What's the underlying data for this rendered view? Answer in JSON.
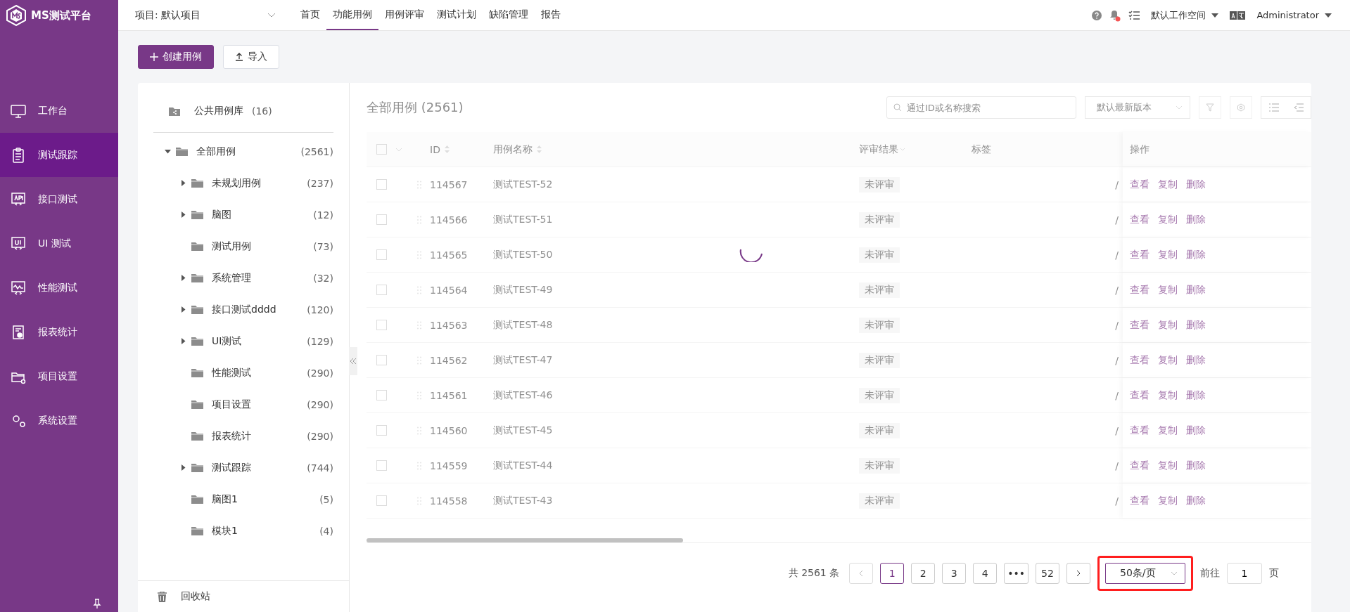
{
  "header": {
    "logo_text": "MS测试平台",
    "project_label": "项目: 默认项目",
    "nav_tabs": [
      {
        "label": "首页",
        "selected": false
      },
      {
        "label": "功能用例",
        "selected": true
      },
      {
        "label": "用例评审",
        "selected": false
      },
      {
        "label": "测试计划",
        "selected": false
      },
      {
        "label": "缺陷管理",
        "selected": false
      },
      {
        "label": "报告",
        "selected": false
      }
    ],
    "notifications_unread": true,
    "workspace": "默认工作空间",
    "user": "Administrator"
  },
  "sidebar": {
    "items": [
      {
        "label": "工作台",
        "selected": false
      },
      {
        "label": "测试跟踪",
        "selected": true
      },
      {
        "label": "接口测试",
        "selected": false
      },
      {
        "label": "UI 测试",
        "selected": false
      },
      {
        "label": "性能测试",
        "selected": false
      },
      {
        "label": "报表统计",
        "selected": false
      },
      {
        "label": "项目设置",
        "selected": false
      },
      {
        "label": "系统设置",
        "selected": false
      }
    ]
  },
  "toolbar": {
    "buttons": [
      "创建用例",
      "导入"
    ]
  },
  "tree": {
    "public_library": {
      "label": "公共用例库",
      "count": "(16)"
    },
    "nodes": [
      {
        "label": "全部用例",
        "count": "(2561)",
        "expanded": true,
        "children": [
          {
            "label": "未规划用例",
            "count": "(237)",
            "expanded": false
          },
          {
            "label": "脑图",
            "count": "(12)",
            "expanded": false
          },
          {
            "label": "测试用例",
            "count": "(73)"
          },
          {
            "label": "系统管理",
            "count": "(32)",
            "expanded": false
          },
          {
            "label": "接口测试dddd",
            "count": "(120)",
            "expanded": false
          },
          {
            "label": "UI测试",
            "count": "(129)",
            "expanded": false
          },
          {
            "label": "性能测试",
            "count": "(290)"
          },
          {
            "label": "项目设置",
            "count": "(290)"
          },
          {
            "label": "报表统计",
            "count": "(290)"
          },
          {
            "label": "测试跟踪",
            "count": "(744)",
            "expanded": false
          },
          {
            "label": "脑图1",
            "count": "(5)"
          },
          {
            "label": "模块1",
            "count": "(4)"
          }
        ]
      }
    ],
    "recycle_bin": "回收站"
  },
  "table": {
    "loading": true,
    "select_all_checked": false,
    "title": "全部用例 (2561)",
    "search": {
      "placeholder": "通过ID或名称搜索"
    },
    "version_select": "默认最新版本",
    "columns": [
      "ID",
      "用例名称",
      "评审结果",
      "标签",
      "操作"
    ],
    "rows": [
      {
        "checked": false,
        "id": "114567",
        "name": "测试TEST-52",
        "review": "未评审",
        "column_5": "/",
        "actions": [
          "查看",
          "复制",
          "删除"
        ]
      },
      {
        "checked": false,
        "id": "114566",
        "name": "测试TEST-51",
        "review": "未评审",
        "column_5": "/",
        "actions": [
          "查看",
          "复制",
          "删除"
        ]
      },
      {
        "checked": false,
        "id": "114565",
        "name": "测试TEST-50",
        "review": "未评审",
        "column_5": "/",
        "actions": [
          "查看",
          "复制",
          "删除"
        ]
      },
      {
        "checked": false,
        "id": "114564",
        "name": "测试TEST-49",
        "review": "未评审",
        "column_5": "/",
        "actions": [
          "查看",
          "复制",
          "删除"
        ]
      },
      {
        "checked": false,
        "id": "114563",
        "name": "测试TEST-48",
        "review": "未评审",
        "column_5": "/",
        "actions": [
          "查看",
          "复制",
          "删除"
        ]
      },
      {
        "checked": false,
        "id": "114562",
        "name": "测试TEST-47",
        "review": "未评审",
        "column_5": "/",
        "actions": [
          "查看",
          "复制",
          "删除"
        ]
      },
      {
        "checked": false,
        "id": "114561",
        "name": "测试TEST-46",
        "review": "未评审",
        "column_5": "/",
        "actions": [
          "查看",
          "复制",
          "删除"
        ]
      },
      {
        "checked": false,
        "id": "114560",
        "name": "测试TEST-45",
        "review": "未评审",
        "column_5": "/",
        "actions": [
          "查看",
          "复制",
          "删除"
        ]
      },
      {
        "checked": false,
        "id": "114559",
        "name": "测试TEST-44",
        "review": "未评审",
        "column_5": "/",
        "actions": [
          "查看",
          "复制",
          "删除"
        ]
      },
      {
        "checked": false,
        "id": "114558",
        "name": "测试TEST-43",
        "review": "未评审",
        "column_5": "/",
        "actions": [
          "查看",
          "复制",
          "删除"
        ]
      }
    ]
  },
  "pagination": {
    "total": "共 2561 条",
    "pages": [
      {
        "label": "1",
        "selected": true
      },
      {
        "label": "2",
        "selected": false
      },
      {
        "label": "3",
        "selected": false
      },
      {
        "label": "4",
        "selected": false
      },
      {
        "label": "•••",
        "selected": false
      },
      {
        "label": "52",
        "selected": false
      }
    ],
    "page_size": {
      "value": "50条/页",
      "highlighted": true
    },
    "goto_label": "前往",
    "goto_value": "1",
    "page_unit": "页"
  }
}
